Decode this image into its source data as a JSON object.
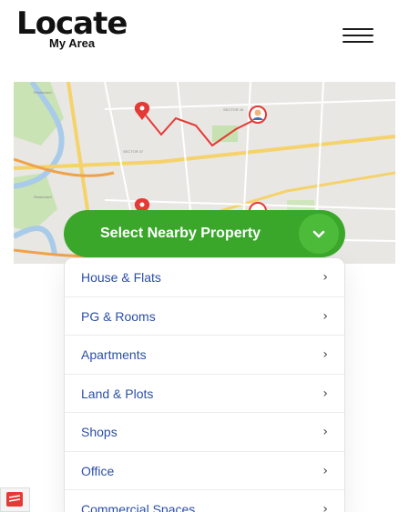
{
  "header": {
    "logo_word": "Locate",
    "logo_sub": "My Area"
  },
  "map": {
    "labels": [
      "SECTOR 45",
      "SECTOR 47",
      "Restaurant"
    ]
  },
  "select": {
    "label": "Select Nearby Property"
  },
  "dropdown": {
    "items": [
      {
        "label": "House & Flats"
      },
      {
        "label": "PG & Rooms"
      },
      {
        "label": "Apartments"
      },
      {
        "label": "Land & Plots"
      },
      {
        "label": "Shops"
      },
      {
        "label": "Office"
      },
      {
        "label": "Commercial Spaces"
      }
    ],
    "arrow": "›"
  },
  "colors": {
    "brand_green": "#3aa72b",
    "route_red": "#e53935",
    "link_blue": "#2b4fa8"
  },
  "icons": {
    "menu": "hamburger-icon",
    "chevron": "chevron-down-icon",
    "pin": "map-pin-icon"
  }
}
